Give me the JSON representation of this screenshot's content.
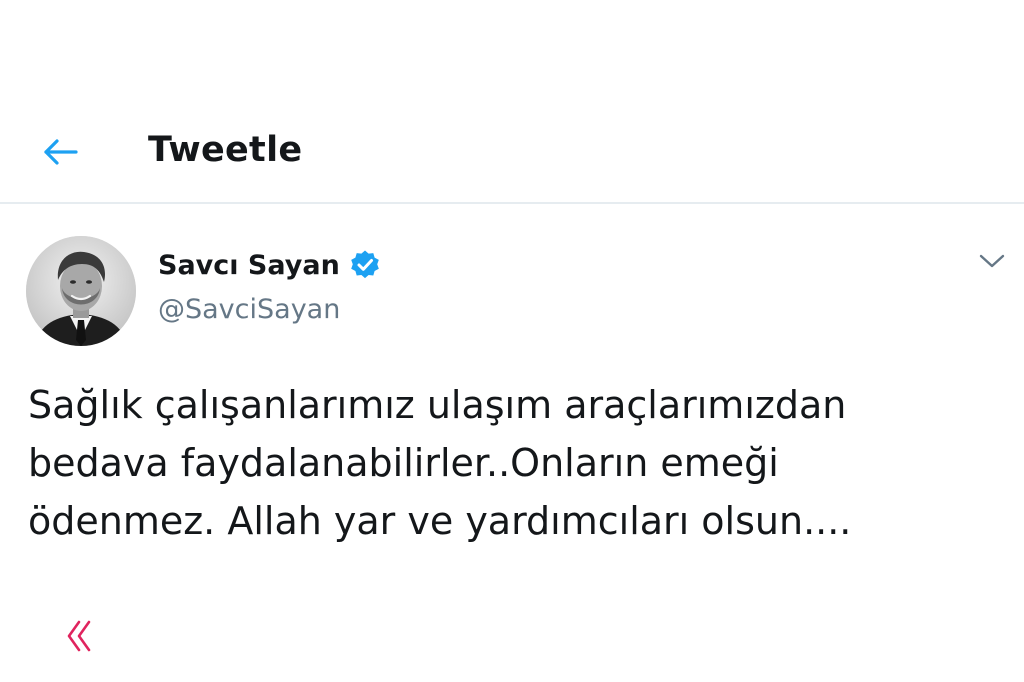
{
  "header": {
    "title": "Tweetle",
    "back_icon": "arrow-left-icon",
    "accent_color": "#1da1f2"
  },
  "tweet": {
    "author": {
      "display_name": "Savcı Sayan",
      "handle": "@SavciSayan",
      "verified": true,
      "verified_icon": "verified-badge-icon",
      "avatar_icon": "avatar-photo"
    },
    "menu_icon": "chevron-down-icon",
    "text_lines": [
      "Sağlık çalışanlarımız ulaşım araçlarımızdan",
      "bedava faydalanabilirler..Onların emeği",
      "ödenmez. Allah yar ve yardımcıları olsun...."
    ],
    "bottom_icon": "double-chevron-left-icon",
    "bottom_icon_color": "#e0245e"
  }
}
